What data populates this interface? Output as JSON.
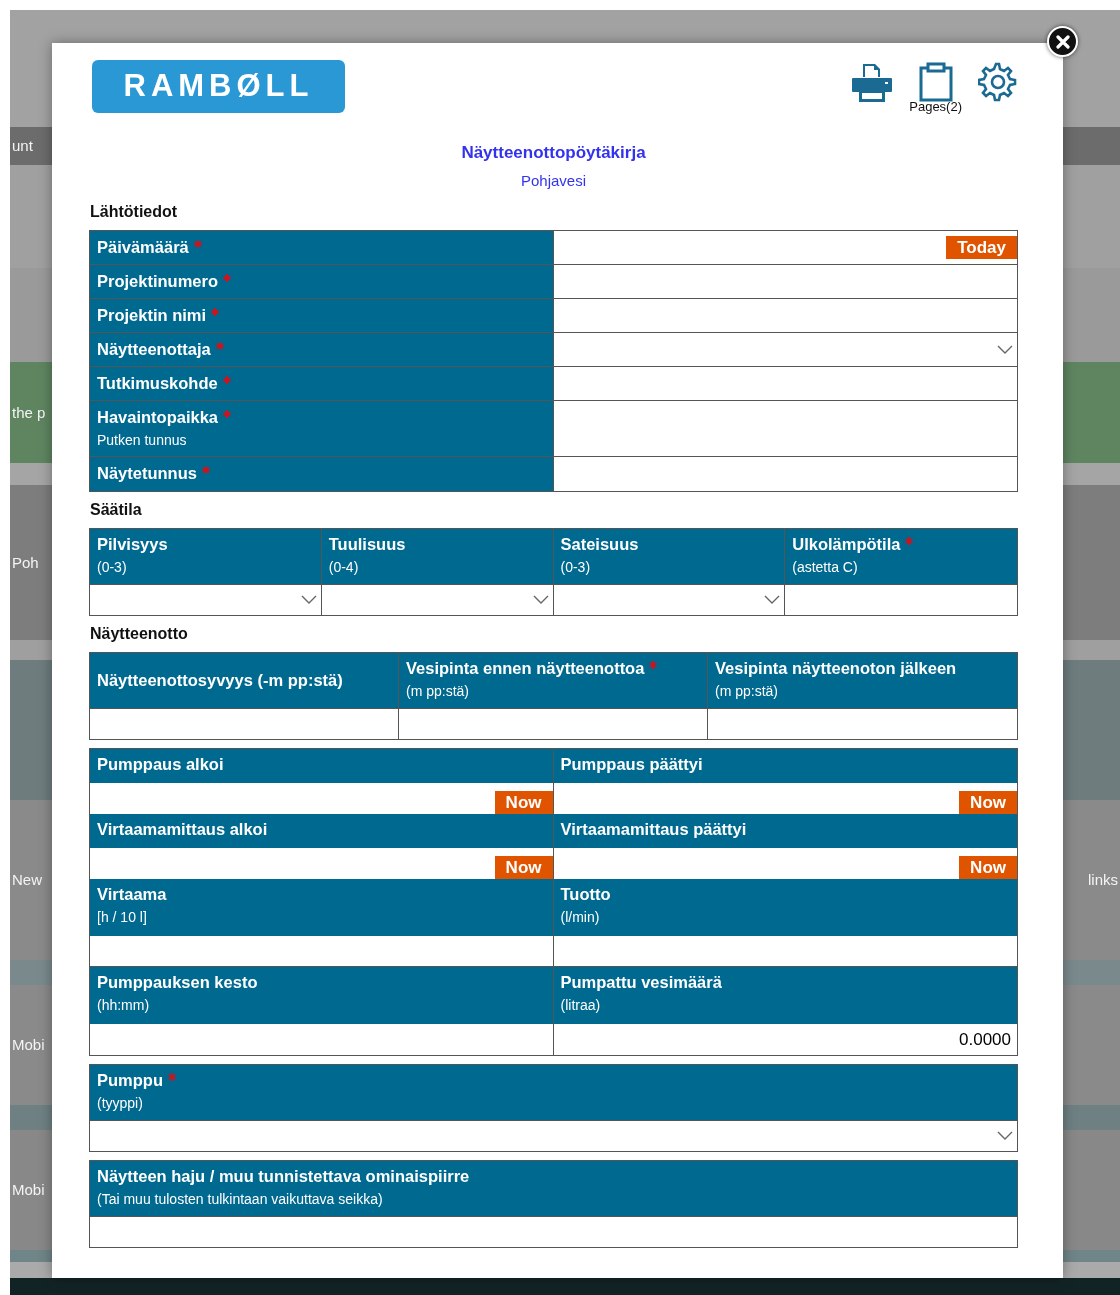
{
  "background_page": {
    "left_fragments": [
      "unt",
      "the p",
      "Poh",
      "New",
      "Mobi",
      "Mobi"
    ],
    "right_fragments": [
      "links"
    ]
  },
  "dialog": {
    "logo": "RAMBØLL",
    "toolbar": [
      {
        "kind": "print"
      },
      {
        "kind": "pages",
        "label": "Pages(2)"
      },
      {
        "kind": "settings"
      }
    ],
    "title": "Näytteenottopöytäkirja",
    "subtitle": "Pohjavesi",
    "sections": [
      {
        "kind": "label_table",
        "heading": "Lähtötiedot",
        "rows": [
          {
            "label": "Päivämäärä",
            "required": true,
            "field": {
              "kind": "date",
              "button": "Today"
            }
          },
          {
            "label": "Projektinumero",
            "required": true,
            "field": {
              "kind": "text"
            }
          },
          {
            "label": "Projektin nimi",
            "required": true,
            "field": {
              "kind": "text"
            }
          },
          {
            "label": "Näytteenottaja",
            "required": true,
            "field": {
              "kind": "select"
            }
          },
          {
            "label": "Tutkimuskohde",
            "required": true,
            "field": {
              "kind": "text"
            }
          },
          {
            "label": "Havaintopaikka",
            "required": true,
            "hint": "Putken tunnus",
            "field": {
              "kind": "text"
            }
          },
          {
            "label": "Näytetunnus",
            "required": true,
            "field": {
              "kind": "text"
            }
          }
        ]
      },
      {
        "kind": "column_table",
        "heading": "Säätila",
        "columns": [
          {
            "label": "Pilvisyys",
            "required": false,
            "hint": "(0-3)",
            "field": {
              "kind": "select"
            }
          },
          {
            "label": "Tuulisuus",
            "required": false,
            "hint": "(0-4)",
            "field": {
              "kind": "select"
            }
          },
          {
            "label": "Sateisuus",
            "required": false,
            "hint": "(0-3)",
            "field": {
              "kind": "select"
            }
          },
          {
            "label": "Ulkolämpötila",
            "required": true,
            "hint": "(astetta C)",
            "field": {
              "kind": "text"
            }
          }
        ]
      },
      {
        "kind": "column_table",
        "heading": "Näytteenotto",
        "columns": [
          {
            "label": "Näytteenottosyvyys (-m pp:stä)",
            "required": false,
            "field": {
              "kind": "text"
            }
          },
          {
            "label": "Vesipinta ennen näytteenottoa",
            "required": true,
            "hint": "(m pp:stä)",
            "field": {
              "kind": "text"
            }
          },
          {
            "label": "Vesipinta näytteenoton jälkeen",
            "required": false,
            "hint": "(m pp:stä)",
            "field": {
              "kind": "text"
            }
          }
        ]
      },
      {
        "kind": "pair_grid",
        "rows": [
          {
            "cells": [
              {
                "label": "Pumppaus alkoi",
                "required": false,
                "field": {
                  "kind": "datetime",
                  "button": "Now"
                }
              },
              {
                "label": "Pumppaus päättyi",
                "required": false,
                "field": {
                  "kind": "datetime",
                  "button": "Now"
                }
              }
            ]
          },
          {
            "cells": [
              {
                "label": "Virtaamamittaus alkoi",
                "required": false,
                "field": {
                  "kind": "datetime",
                  "button": "Now"
                }
              },
              {
                "label": "Virtaamamittaus päättyi",
                "required": false,
                "field": {
                  "kind": "datetime",
                  "button": "Now"
                }
              }
            ]
          },
          {
            "cells": [
              {
                "label": "Virtaama",
                "required": false,
                "hint": "[h / 10 l]",
                "field": {
                  "kind": "text"
                }
              },
              {
                "label": "Tuotto",
                "required": false,
                "hint": "(l/min)",
                "field": {
                  "kind": "text"
                }
              }
            ]
          },
          {
            "cells": [
              {
                "label": "Pumppauksen kesto",
                "required": false,
                "hint": "(hh:mm)",
                "field": {
                  "kind": "text"
                }
              },
              {
                "label": "Pumpattu vesimäärä",
                "required": false,
                "hint": "(litraa)",
                "field": {
                  "kind": "number",
                  "value": "0.0000"
                }
              }
            ]
          }
        ]
      },
      {
        "kind": "column_table",
        "columns": [
          {
            "label": "Pumppu",
            "required": true,
            "hint": "(tyyppi)",
            "field": {
              "kind": "select"
            }
          }
        ]
      },
      {
        "kind": "column_table",
        "columns": [
          {
            "label": "Näytteen haju / muu tunnistettava ominaispiirre",
            "required": false,
            "hint": "(Tai muu tulosten tulkintaan vaikuttava seikka)",
            "field": {
              "kind": "text"
            }
          }
        ]
      }
    ]
  }
}
